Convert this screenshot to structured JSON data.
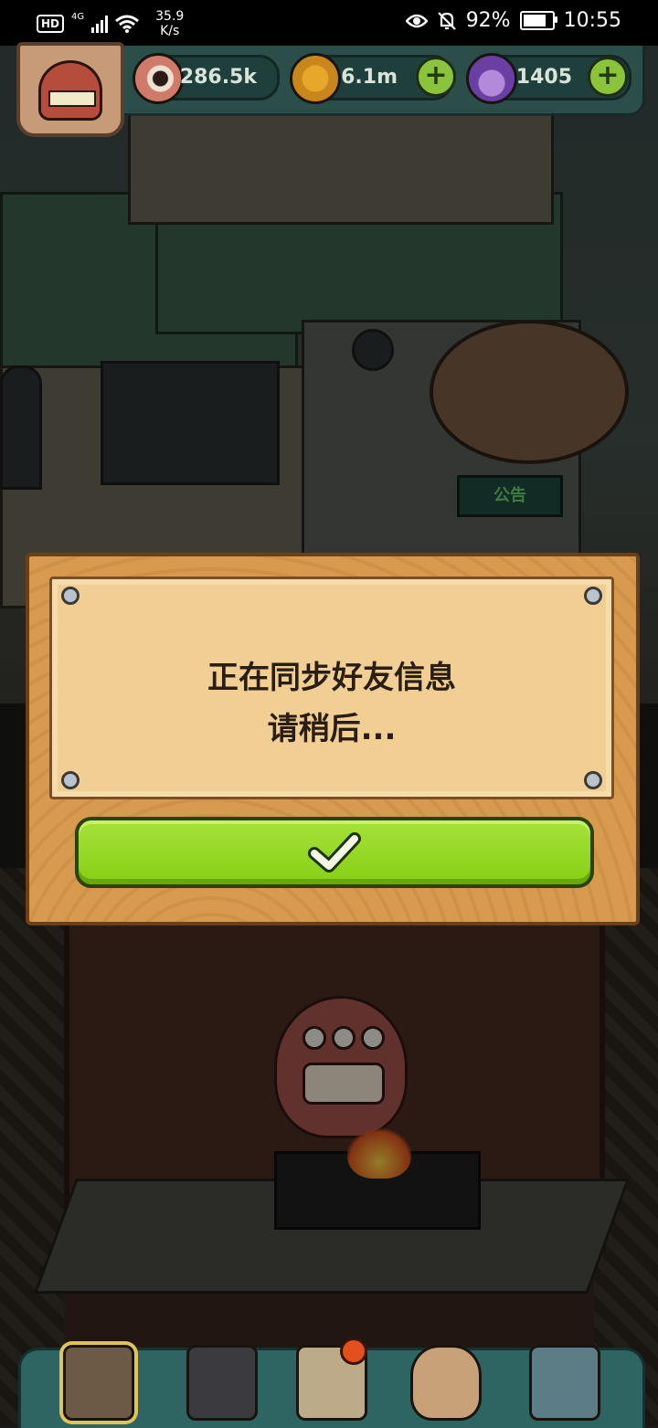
{
  "status_bar": {
    "hd": "HD",
    "network": "4G",
    "speed_value": "35.9",
    "speed_unit": "K/s",
    "battery_percent": "92%",
    "battery_level": 0.92,
    "time": "10:55"
  },
  "resources": {
    "eyes": "286.5k",
    "coins": "6.1m",
    "potions": "1405"
  },
  "scene": {
    "notice_sign": "公告"
  },
  "dialog": {
    "line1": "正在同步好友信息",
    "line2": "请稍后...",
    "confirm_icon": "checkmark-icon"
  },
  "bottom_nav": {
    "items": [
      {
        "icon": "building-icon",
        "active": true
      },
      {
        "icon": "monster-icon",
        "active": false
      },
      {
        "icon": "recipe-book-icon",
        "active": false,
        "badge": true
      },
      {
        "icon": "money-bag-icon",
        "active": false
      },
      {
        "icon": "grid-menu-icon",
        "active": false
      }
    ]
  },
  "colors": {
    "confirm_green": "#8bd11a",
    "dialog_wood": "#d79a4e",
    "dialog_paper": "#f1cf94",
    "topbar_teal": "#2d5552"
  }
}
